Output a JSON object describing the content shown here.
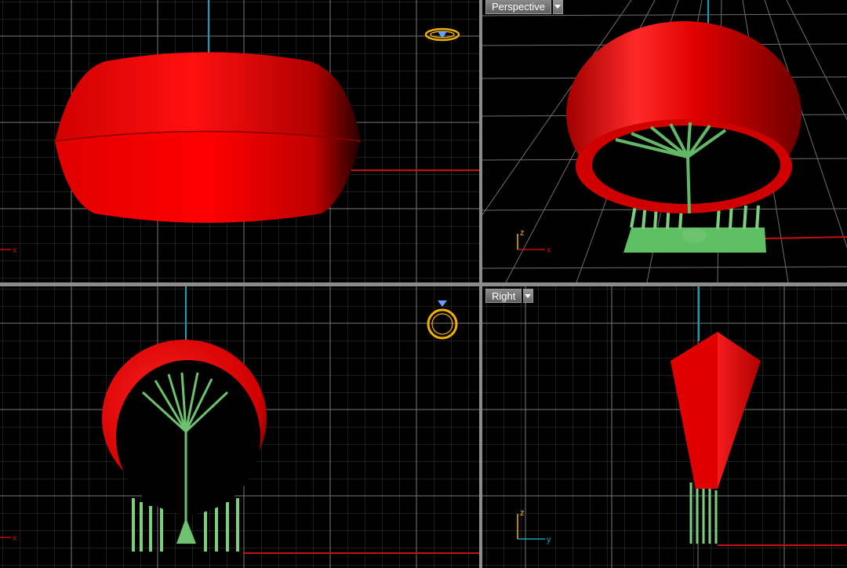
{
  "viewports": {
    "top_left": {
      "name": "",
      "axis_label": "x"
    },
    "perspective": {
      "name": "Perspective",
      "axis_x": "x",
      "axis_z": "z"
    },
    "bottom_left": {
      "name": "",
      "axis_label": "x"
    },
    "right": {
      "name": "Right",
      "axis_y": "y",
      "axis_z": "z"
    }
  },
  "icons": {
    "top_left_widget": "ring-top-view-icon",
    "bottom_left_widget": "ring-front-view-icon",
    "viewport_menu": "chevron-down-icon"
  },
  "colors": {
    "background": "#000000",
    "grid_minor": "#3a3a3a",
    "grid_major": "#7a7a7a",
    "ring_body": "#ff0000",
    "supports": "#7ccf7f",
    "axis_x": "#c41111",
    "axis_vertical": "#0fa3b5",
    "widget": "#f2b100"
  }
}
